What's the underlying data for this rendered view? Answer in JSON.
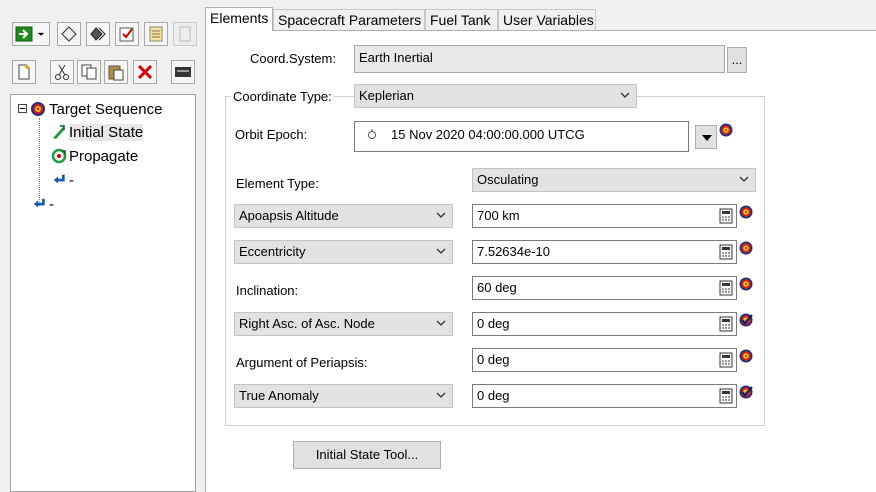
{
  "tree": {
    "items": [
      {
        "label": "Target Sequence"
      },
      {
        "label": "Initial State"
      },
      {
        "label": "Propagate"
      },
      {
        "label": "-"
      },
      {
        "label": "-"
      }
    ]
  },
  "tabs": [
    "Elements",
    "Spacecraft Parameters",
    "Fuel Tank",
    "User Variables"
  ],
  "elements": {
    "coord_system_label": "Coord.System:",
    "coord_system_value": "Earth Inertial",
    "browse_label": "...",
    "coordinate_type_label": "Coordinate Type:",
    "coordinate_type_value": "Keplerian",
    "orbit_epoch_label": "Orbit Epoch:",
    "orbit_epoch_value": "15 Nov 2020 04:00:00.000 UTCG",
    "element_type_label": "Element Type:",
    "element_type_value": "Osculating",
    "rows": [
      {
        "label": "Apoapsis Altitude",
        "value": "700 km"
      },
      {
        "label": "Eccentricity",
        "value": "7.52634e-10"
      },
      {
        "label": "Inclination:",
        "value": "60 deg"
      },
      {
        "label": "Right Asc. of Asc. Node",
        "value": "0 deg"
      },
      {
        "label": "Argument of Periapsis:",
        "value": "0 deg"
      },
      {
        "label": "True Anomaly",
        "value": "0 deg"
      }
    ],
    "initial_state_tool_label": "Initial State Tool..."
  }
}
